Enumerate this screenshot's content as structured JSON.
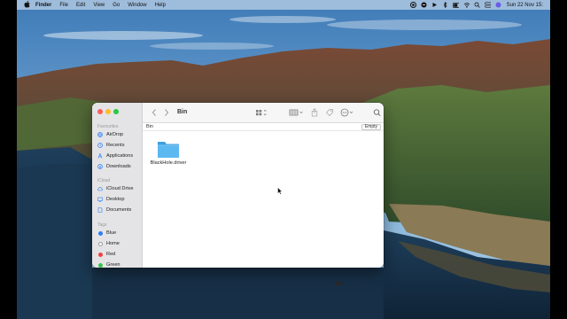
{
  "menubar": {
    "apple_icon": "apple-logo-icon",
    "app_name": "Finder",
    "menus": [
      "File",
      "Edit",
      "View",
      "Go",
      "Window",
      "Help"
    ],
    "clock": "Sun 22 Nov  15:"
  },
  "window": {
    "title": "Bin",
    "path_crumb": "Bin",
    "empty_button": "Empty",
    "sidebar": {
      "favourites_label": "Favourites",
      "favourites": [
        {
          "label": "AirDrop",
          "icon": "airdrop-icon"
        },
        {
          "label": "Recents",
          "icon": "clock-icon"
        },
        {
          "label": "Applications",
          "icon": "applications-icon"
        },
        {
          "label": "Downloads",
          "icon": "download-icon"
        }
      ],
      "icloud_label": "iCloud",
      "icloud": [
        {
          "label": "iCloud Drive",
          "icon": "cloud-icon"
        },
        {
          "label": "Desktop",
          "icon": "desktop-icon"
        },
        {
          "label": "Documents",
          "icon": "document-icon"
        }
      ],
      "tags_label": "Tags",
      "tags": [
        {
          "label": "Blue",
          "color": "#2f7df6"
        },
        {
          "label": "Home",
          "color": "#ffffff"
        },
        {
          "label": "Red",
          "color": "#f44040"
        },
        {
          "label": "Green",
          "color": "#35c24a"
        }
      ]
    },
    "files": [
      {
        "name": "BlackHole.driver",
        "icon": "folder-icon",
        "color": "#5cb8f0"
      }
    ]
  }
}
